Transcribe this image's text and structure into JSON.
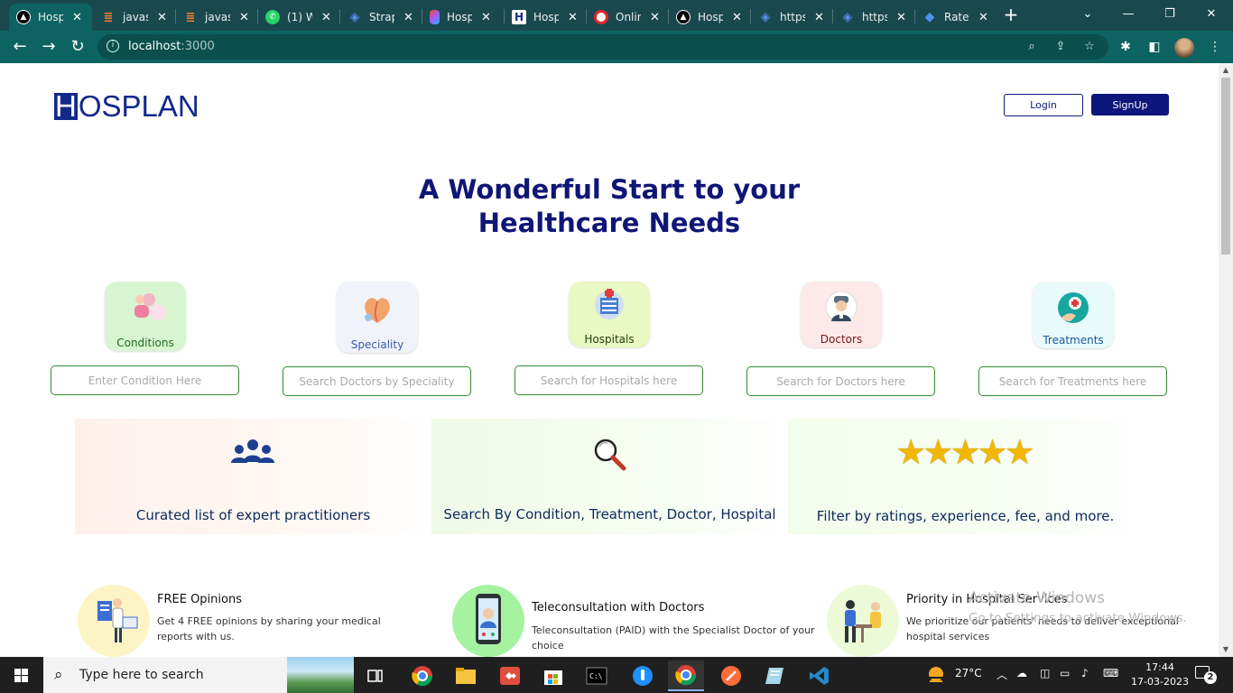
{
  "browser": {
    "tabs": [
      {
        "title": "Hosp",
        "favicon": "nextjs-icon",
        "active": true
      },
      {
        "title": "javas",
        "favicon": "stackoverflow-icon"
      },
      {
        "title": "javas",
        "favicon": "stackoverflow-icon"
      },
      {
        "title": "(1) W",
        "favicon": "whatsapp-icon"
      },
      {
        "title": "Strap",
        "favicon": "strapi-icon"
      },
      {
        "title": "Hosp",
        "favicon": "figma-icon"
      },
      {
        "title": "Hosp",
        "favicon": "hosplan-icon"
      },
      {
        "title": "Onlin",
        "favicon": "opera-icon"
      },
      {
        "title": "Hosp",
        "favicon": "nextjs-icon"
      },
      {
        "title": "https",
        "favicon": "strapi-icon"
      },
      {
        "title": "https",
        "favicon": "strapi-icon"
      },
      {
        "title": "Rate",
        "favicon": "diamond-icon"
      }
    ],
    "url_host": "localhost",
    "url_port": ":3000",
    "colors": {
      "tabbar": "#1a484f",
      "toolbar": "#0d6361"
    }
  },
  "header": {
    "logo_first": "H",
    "logo_rest": "OSPLAN",
    "login_label": "Login",
    "signup_label": "SignUp"
  },
  "hero": {
    "line1": "A Wonderful Start to your",
    "line2": "Healthcare Needs"
  },
  "categories": [
    {
      "label": "Conditions",
      "placeholder": "Enter Condition Here",
      "color": "#d8f5d2",
      "label_color": "#1e6b1e"
    },
    {
      "label": "Speciality",
      "placeholder": "Search Doctors by Speciality",
      "color": "#f1f3fb",
      "label_color": "#3a5aa8"
    },
    {
      "label": "Hospitals",
      "placeholder": "Search for Hospitals here",
      "color": "#eaf8c2",
      "label_color": "#1f3d0c"
    },
    {
      "label": "Doctors",
      "placeholder": "Search for Doctors here",
      "color": "#fde9e9",
      "label_color": "#7a1010"
    },
    {
      "label": "Treatments",
      "placeholder": "Search for Treatments here",
      "color": "#e9fafa",
      "label_color": "#1858a0"
    }
  ],
  "features": [
    {
      "text": "Curated list of expert practitioners",
      "icon": "users-group-icon"
    },
    {
      "text": "Search By Condition, Treatment, Doctor, Hospital",
      "icon": "magnifier-icon"
    },
    {
      "text": "Filter by ratings, experience, fee, and more.",
      "icon": "five-stars-icon",
      "rating": 5
    }
  ],
  "services": [
    {
      "title": "FREE Opinions",
      "desc": "Get 4 FREE opinions by sharing your medical reports with us."
    },
    {
      "title": "Teleconsultation with Doctors",
      "desc": "Teleconsultation (PAID) with the Specialist Doctor of your choice"
    },
    {
      "title": "Priority in Hospital Services",
      "desc": "We prioritize our patients' needs to deliver exceptional hospital services"
    }
  ],
  "watermark": {
    "line1": "Activate Windows",
    "line2": "Go to Settings to activate Windows."
  },
  "taskbar": {
    "search_placeholder": "Type here to search",
    "temperature": "27°C",
    "time": "17:44",
    "date": "17-03-2023",
    "notification_count": "2"
  }
}
